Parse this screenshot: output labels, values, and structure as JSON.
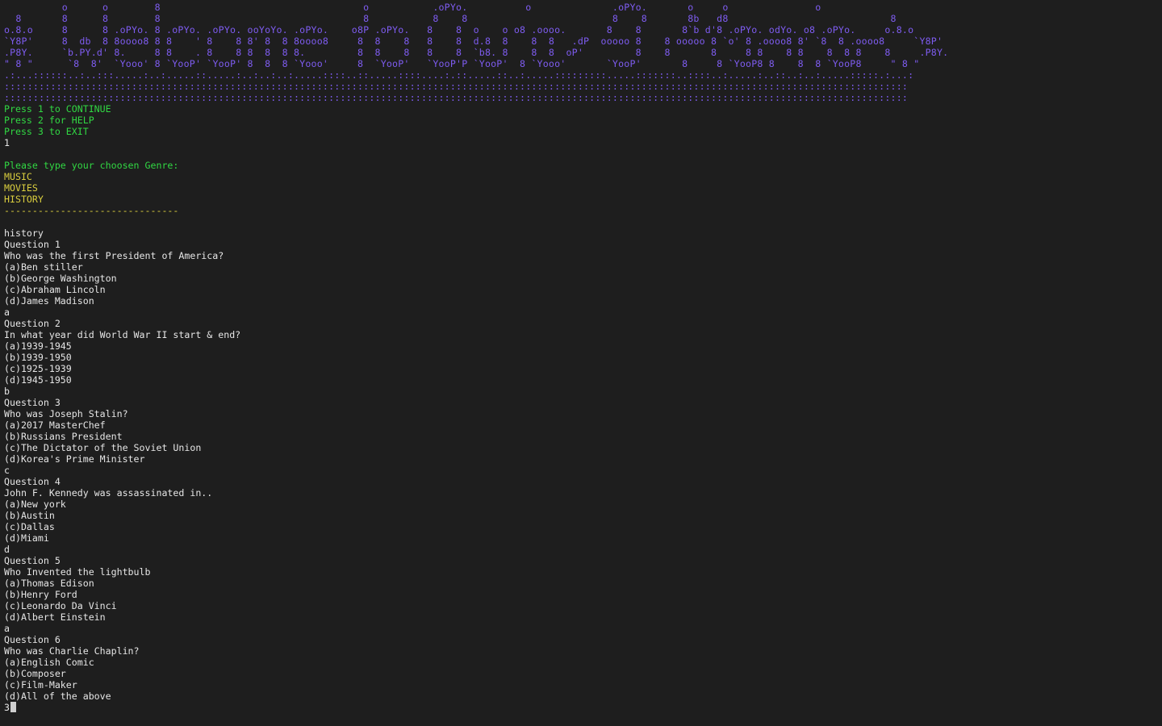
{
  "banner": [
    "          o      o        8                                   o           .oPYo.          o              .oPYo.       o     o               o",
    "  8       8      8        8                                   8           8    8                         8    8       8b   d8                            8",
    "o.8.o     8      8 .oPYo. 8 .oPYo. .oPYo. ooYoYo. .oPYo.    o8P .oPYo.   8    8  o    o o8 .oooo.       8    8       8`b d'8 .oPYo. odYo. o8 .oPYo.     o.8.o",
    "`Y8P'     8  db  8 8oooo8 8 8    ' 8    8 8' 8  8 8oooo8     8  8    8   8    8  d.8  8    8  8   .dP  ooooo 8    8 ooooo 8 `o' 8 .oooo8 8' `8  8 .oooo8     `Y8P'",
    ".P8Y.     `b.PY.d' 8.     8 8    . 8    8 8  8  8 8.         8  8    8   8    8  `b8. 8    8  8  oP'         8    8       8     8 8    8 8    8  8 8    8     .P8Y.",
    "\" 8 \"      `8  8'  `Yooo' 8 `YooP' `YooP' 8  8  8 `Yooo'     8  `YooP'   `YooP'P `YooP'  8 `Yooo'       `YooP'       8     8 `YooP8 8    8  8 `YooP8     \" 8 \"",
    ".:...::::::..:..:::.....:..:.....::.....:..:..:..:.....::::..::.....::::....:.::.....::..:.....:::::::::.....:::::::..::::..:.....:..::..:..:.....:::::.:...:",
    "::::::::::::::::::::::::::::::::::::::::::::::::::::::::::::::::::::::::::::::::::::::::::::::::::::::::::::::::::::::::::::::::::::::::::::::::::::::::::::",
    "::::::::::::::::::::::::::::::::::::::::::::::::::::::::::::::::::::::::::::::::::::::::::::::::::::::::::::::::::::::::::::::::::::::::::::::::::::::::::::"
  ],
  "menu": {
    "continue": "Press 1 to CONTINUE",
    "help": "Press 2 for HELP",
    "exit": "Press 3 to EXIT",
    "input": "1"
  },
  "genre": {
    "prompt": "Please type your choosen Genre:",
    "options": [
      "MUSIC",
      "MOVIES",
      "HISTORY"
    ],
    "divider": "-------------------------------",
    "input": "history"
  },
  "questions": [
    {
      "header": "Question 1",
      "text": "Who was the first President of America?",
      "options": [
        "(a)Ben stiller",
        "(b)George Washington",
        "(c)Abraham Lincoln",
        "(d)James Madison"
      ],
      "answer": "a"
    },
    {
      "header": "Question 2",
      "text": "In what year did World War II start & end?",
      "options": [
        "(a)1939-1945",
        "(b)1939-1950",
        "(c)1925-1939",
        "(d)1945-1950"
      ],
      "answer": "b"
    },
    {
      "header": "Question 3",
      "text": "Who was Joseph Stalin?",
      "options": [
        "(a)2017 MasterChef",
        "(b)Russians President",
        "(c)The Dictator of the Soviet Union",
        "(d)Korea's Prime Minister"
      ],
      "answer": "c"
    },
    {
      "header": "Question 4",
      "text": "John F. Kennedy was assassinated in..",
      "options": [
        "(a)New york",
        "(b)Austin",
        "(c)Dallas",
        "(d)Miami"
      ],
      "answer": "d"
    },
    {
      "header": "Question 5",
      "text": "Who Invented the lightbulb",
      "options": [
        "(a)Thomas Edison",
        "(b)Henry Ford",
        "(c)Leonardo Da Vinci",
        "(d)Albert Einstein"
      ],
      "answer": "a"
    },
    {
      "header": "Question 6",
      "text": "Who was Charlie Chaplin?",
      "options": [
        "(a)English Comic",
        "(b)Composer",
        "(c)Film-Maker",
        "(d)All of the above"
      ],
      "answer": "3"
    }
  ],
  "colors": {
    "background": "#1e1e1e",
    "banner": "#7e5cf0",
    "menu": "#31d843",
    "genre": "#d9cd3e",
    "text": "#e6e6e6"
  }
}
